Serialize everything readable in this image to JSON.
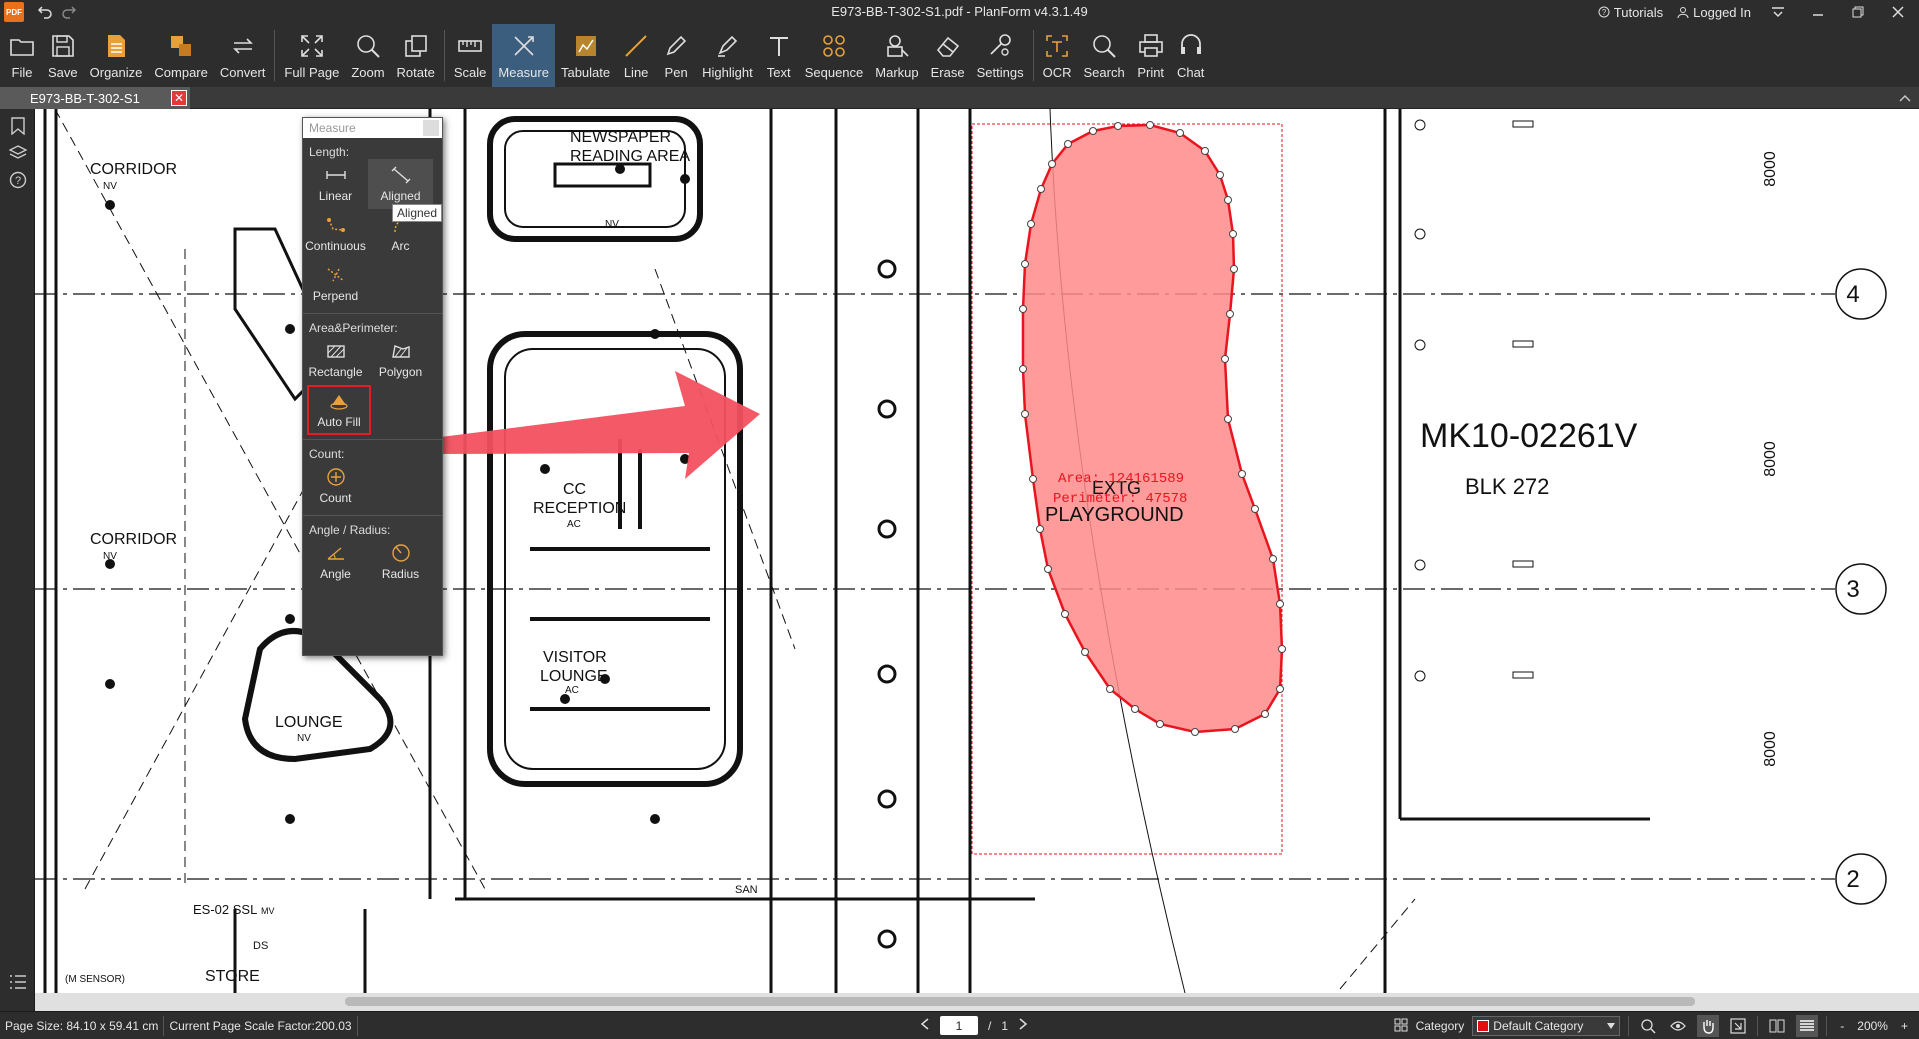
{
  "app": {
    "logo_text": "PDF",
    "window_title": "E973-BB-T-302-S1.pdf - PlanForm v4.3.1.49",
    "tutorials_label": "Tutorials",
    "login_label": "Logged In"
  },
  "toolbar": {
    "file": "File",
    "save": "Save",
    "organize": "Organize",
    "compare": "Compare",
    "convert": "Convert",
    "full_page": "Full Page",
    "zoom": "Zoom",
    "rotate": "Rotate",
    "scale": "Scale",
    "measure": "Measure",
    "tabulate": "Tabulate",
    "line": "Line",
    "pen": "Pen",
    "highlight": "Highlight",
    "text": "Text",
    "sequence": "Sequence",
    "markup": "Markup",
    "erase": "Erase",
    "settings": "Settings",
    "ocr": "OCR",
    "search": "Search",
    "print": "Print",
    "chat": "Chat"
  },
  "tabs": [
    {
      "label": "E973-BB-T-302-S1",
      "close": "✕"
    }
  ],
  "measure_panel": {
    "title": "Measure",
    "length_header": "Length:",
    "linear": "Linear",
    "aligned": "Aligned",
    "aligned_tooltip": "Aligned",
    "continuous": "Continuous",
    "arc": "Arc",
    "perpend": "Perpend",
    "area_header": "Area&Perimeter:",
    "rectangle": "Rectangle",
    "polygon": "Polygon",
    "auto_fill": "Auto Fill",
    "count_header": "Count:",
    "count": "Count",
    "angle_header": "Angle / Radius:",
    "angle": "Angle",
    "radius": "Radius"
  },
  "drawing": {
    "labels": {
      "corridor_top": "CORRIDOR",
      "corridor_top_sub": "NV",
      "corridor_bottom": "CORRIDOR",
      "corridor_bottom_sub": "NV",
      "newspaper": "NEWSPAPER",
      "reading_area": "READING AREA",
      "newspaper_sub": "NV",
      "cc": "CC",
      "reception": "RECEPTION",
      "reception_sub": "AC",
      "visitor": "VISITOR",
      "lounge": "LOUNGE",
      "visitor_sub": "AC",
      "lounge2": "LOUNGE",
      "lounge2_sub": "NV",
      "es02": "ES-02 SSL",
      "es02_sub": "MV",
      "store": "STORE",
      "sensor": "(M SENSOR)",
      "san": "SAN",
      "ds": "DS",
      "extg": "EXTG",
      "playground": "PLAYGROUND",
      "block_code": "MK10-02261V",
      "block_name": "BLK 272",
      "dim_8000_a": "8000",
      "dim_8000_b": "8000",
      "dim_8000_c": "8000",
      "grid_4": "4",
      "grid_3": "3",
      "grid_2": "2"
    },
    "measurement": {
      "area_text": "Area: 124161589",
      "perimeter_text": "Perimeter: 47578",
      "fill_color": "#ff8a8a",
      "stroke_color": "#e8141e"
    },
    "arrow_color": "#f2505f"
  },
  "status": {
    "page_size": "Page Size: 84.10 x 59.41 cm",
    "scale_factor": "Current Page Scale Factor:200.03",
    "page_current": "1",
    "page_sep": "/",
    "page_total": "1",
    "category_label": "Category",
    "category_value": "Default Category",
    "category_color": "#e01010",
    "zoom_level": "200%",
    "zoom_minus": "-",
    "zoom_plus": "+"
  }
}
